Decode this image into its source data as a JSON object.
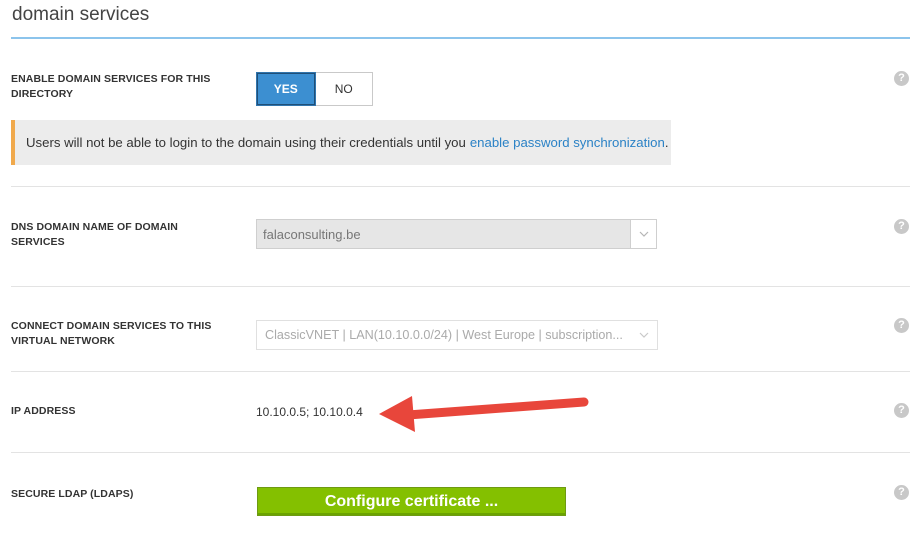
{
  "page": {
    "title": "domain services"
  },
  "enable": {
    "label": "ENABLE DOMAIN SERVICES FOR THIS DIRECTORY",
    "yes_label": "YES",
    "no_label": "NO",
    "selected": "YES"
  },
  "info_banner": {
    "text": "Users will not be able to login to the domain using their credentials until you",
    "link_text": "enable password synchronization",
    "suffix": "."
  },
  "dns": {
    "label": "DNS DOMAIN NAME OF DOMAIN SERVICES",
    "value": "falaconsulting.be"
  },
  "vnet": {
    "label": "CONNECT DOMAIN SERVICES TO THIS VIRTUAL NETWORK",
    "value": "ClassicVNET | LAN(10.10.0.0/24) | West Europe | subscription..."
  },
  "ip": {
    "label": "IP ADDRESS",
    "value": "10.10.0.5; 10.10.0.4"
  },
  "ldaps": {
    "label": "SECURE LDAP (LDAPS)",
    "button_label": "Configure certificate ..."
  },
  "help_glyph": "?",
  "colors": {
    "accent": "#3c8fd1",
    "link": "#2b82c6",
    "warning_bar": "#f0a94c",
    "button_green": "#84c000",
    "annotation_arrow": "#e8463b"
  },
  "icons": [
    "help-icon",
    "chevron-down-icon",
    "annotation-arrow"
  ]
}
